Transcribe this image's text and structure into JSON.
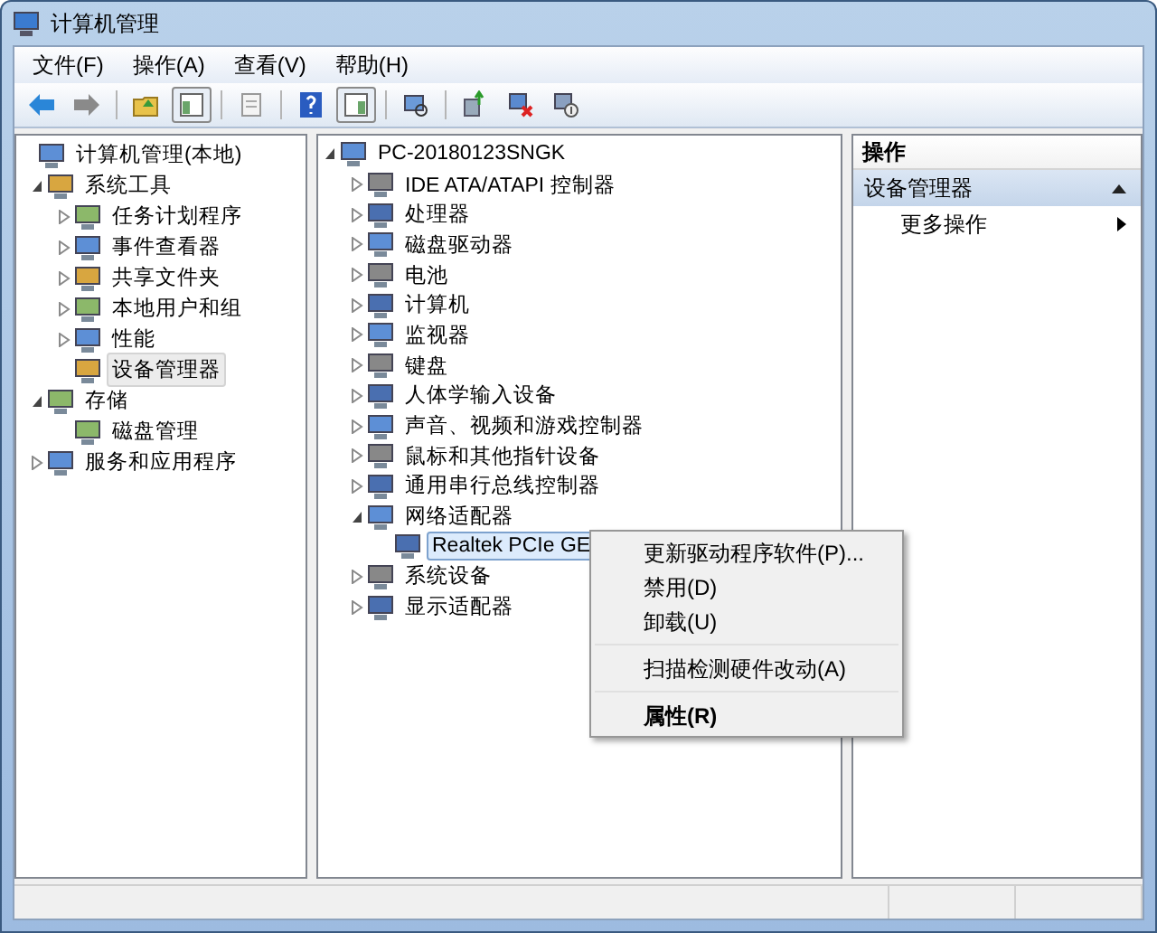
{
  "window": {
    "title": "计算机管理"
  },
  "menu": [
    "文件(F)",
    "操作(A)",
    "查看(V)",
    "帮助(H)"
  ],
  "left_tree": [
    {
      "label": "计算机管理(本地)",
      "selected": false,
      "children": [
        {
          "label": "系统工具",
          "expanded": true,
          "selected": false,
          "children": [
            {
              "label": "任务计划程序",
              "expanded": false,
              "selected": false
            },
            {
              "label": "事件查看器",
              "expanded": false,
              "selected": false
            },
            {
              "label": "共享文件夹",
              "expanded": false,
              "selected": false
            },
            {
              "label": "本地用户和组",
              "expanded": false,
              "selected": false
            },
            {
              "label": "性能",
              "expanded": false,
              "selected": false
            },
            {
              "label": "设备管理器",
              "selected": true
            }
          ]
        },
        {
          "label": "存储",
          "expanded": true,
          "selected": false,
          "children": [
            {
              "label": "磁盘管理",
              "selected": false
            }
          ]
        },
        {
          "label": "服务和应用程序",
          "expanded": false,
          "selected": false
        }
      ]
    }
  ],
  "device_tree": [
    {
      "label": "PC-20180123SNGK",
      "expanded": true,
      "selected": false,
      "children": [
        {
          "label": "IDE ATA/ATAPI 控制器",
          "expanded": false,
          "selected": false
        },
        {
          "label": "处理器",
          "expanded": false,
          "selected": false
        },
        {
          "label": "磁盘驱动器",
          "expanded": false,
          "selected": false
        },
        {
          "label": "电池",
          "expanded": false,
          "selected": false
        },
        {
          "label": "计算机",
          "expanded": false,
          "selected": false
        },
        {
          "label": "监视器",
          "expanded": false,
          "selected": false
        },
        {
          "label": "键盘",
          "expanded": false,
          "selected": false
        },
        {
          "label": "人体学输入设备",
          "expanded": false,
          "selected": false
        },
        {
          "label": "声音、视频和游戏控制器",
          "expanded": false,
          "selected": false
        },
        {
          "label": "鼠标和其他指针设备",
          "expanded": false,
          "selected": false
        },
        {
          "label": "通用串行总线控制器",
          "expanded": false,
          "selected": false
        },
        {
          "label": "网络适配器",
          "expanded": true,
          "selected": false,
          "children": [
            {
              "label": "Realtek PCIe GE",
              "selected": true
            }
          ]
        },
        {
          "label": "系统设备",
          "expanded": false,
          "selected": false
        },
        {
          "label": "显示适配器",
          "expanded": false,
          "selected": false
        }
      ]
    }
  ],
  "context_menu": [
    {
      "label": "更新驱动程序软件(P)...",
      "bold": false,
      "separator_after": false
    },
    {
      "label": "禁用(D)",
      "bold": false,
      "separator_after": false
    },
    {
      "label": "卸载(U)",
      "bold": false,
      "separator_after": true
    },
    {
      "label": "扫描检测硬件改动(A)",
      "bold": false,
      "separator_after": true
    },
    {
      "label": "属性(R)",
      "bold": true,
      "separator_after": false
    }
  ],
  "actions": {
    "header": "操作",
    "section": {
      "label": "设备管理器",
      "expanded": true
    },
    "items": [
      {
        "label": "更多操作"
      }
    ]
  }
}
